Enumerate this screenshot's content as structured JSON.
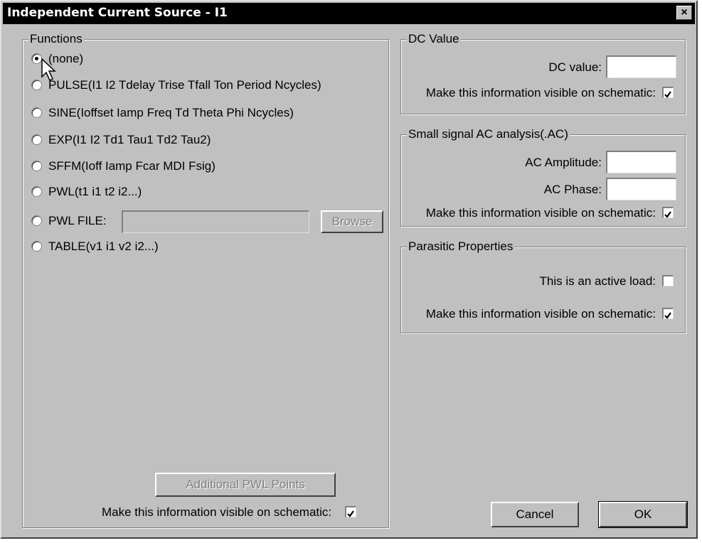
{
  "window": {
    "title": "Independent Current Source - I1",
    "close_label": "×"
  },
  "functions": {
    "legend": "Functions",
    "options": [
      {
        "label": "(none)",
        "checked": true
      },
      {
        "label": "PULSE(I1 I2 Tdelay Trise Tfall Ton Period Ncycles)",
        "checked": false
      },
      {
        "label": "SINE(Ioffset Iamp Freq Td Theta Phi Ncycles)",
        "checked": false
      },
      {
        "label": "EXP(I1 I2 Td1 Tau1 Td2 Tau2)",
        "checked": false
      },
      {
        "label": "SFFM(Ioff Iamp Fcar MDI Fsig)",
        "checked": false
      },
      {
        "label": "PWL(t1 i1 t2 i2...)",
        "checked": false
      },
      {
        "label": "PWL FILE:",
        "checked": false
      },
      {
        "label": "TABLE(v1 i1 v2 i2...)",
        "checked": false
      }
    ],
    "pwl_file_value": "",
    "browse_label": "Browse",
    "additional_pwl_label": "Additional PWL Points",
    "visible_label": "Make this information visible on schematic:",
    "visible_checked": true
  },
  "dc": {
    "legend": "DC Value",
    "value_label": "DC value:",
    "value": "",
    "visible_label": "Make this information visible on schematic:",
    "visible_checked": true
  },
  "ac": {
    "legend": "Small signal AC analysis(.AC)",
    "amplitude_label": "AC Amplitude:",
    "amplitude": "",
    "phase_label": "AC Phase:",
    "phase": "",
    "visible_label": "Make this information visible on schematic:",
    "visible_checked": true
  },
  "parasitic": {
    "legend": "Parasitic Properties",
    "active_load_label": "This is an active load:",
    "active_load_checked": false,
    "visible_label": "Make this information visible on schematic:",
    "visible_checked": true
  },
  "buttons": {
    "cancel": "Cancel",
    "ok": "OK"
  },
  "icons": {
    "close": "close-icon",
    "cursor": "mouse-cursor-icon"
  }
}
